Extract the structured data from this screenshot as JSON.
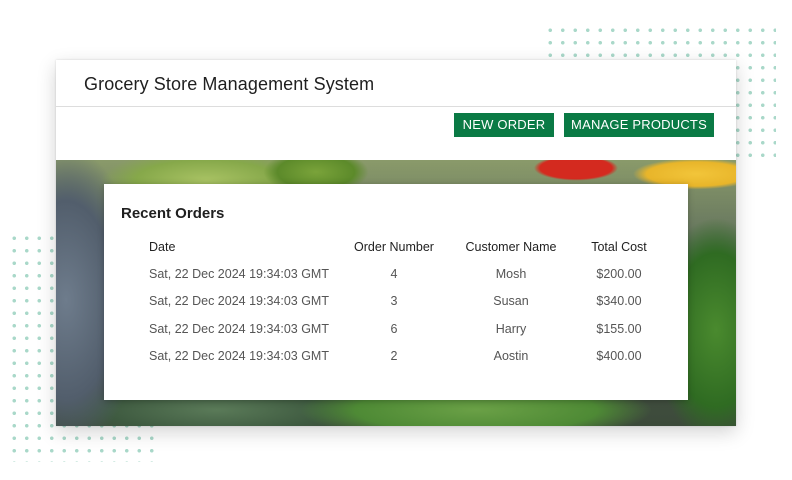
{
  "app": {
    "title": "Grocery Store Management System"
  },
  "toolbar": {
    "new_order_label": "NEW ORDER",
    "manage_products_label": "MANAGE PRODUCTS"
  },
  "colors": {
    "accent": "#0a7a45",
    "dots": "#a9d8c9"
  },
  "orders": {
    "title": "Recent Orders",
    "columns": [
      "Date",
      "Order Number",
      "Customer Name",
      "Total Cost"
    ],
    "rows": [
      {
        "date": "Sat, 22 Dec 2024 19:34:03 GMT",
        "number": "4",
        "customer": "Mosh",
        "cost": "$200.00"
      },
      {
        "date": "Sat, 22 Dec 2024 19:34:03 GMT",
        "number": "3",
        "customer": "Susan",
        "cost": "$340.00"
      },
      {
        "date": "Sat, 22 Dec 2024 19:34:03 GMT",
        "number": "6",
        "customer": "Harry",
        "cost": "$155.00"
      },
      {
        "date": "Sat, 22 Dec 2024 19:34:03 GMT",
        "number": "2",
        "customer": "Aostin",
        "cost": "$400.00"
      }
    ]
  }
}
